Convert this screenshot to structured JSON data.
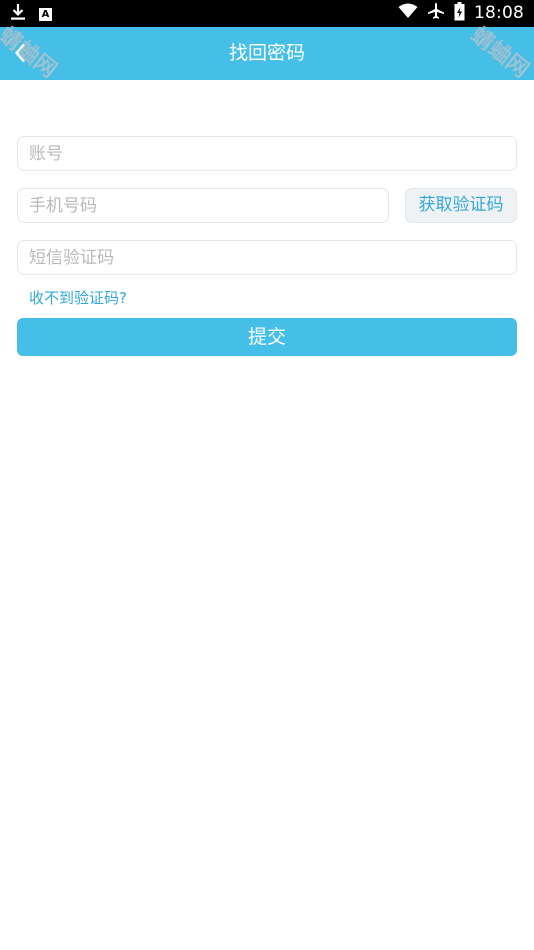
{
  "status_bar": {
    "time": "18:08",
    "notification_icons": [
      "download-icon",
      "a-icon"
    ],
    "system_icons": [
      "wifi-icon",
      "airplane-icon",
      "battery-icon"
    ],
    "a_glyph": "A"
  },
  "header": {
    "title": "找回密码",
    "back_icon": "chevron-left-icon",
    "watermark_text": "蜻蛐网",
    "background_color": "#45bfe8"
  },
  "form": {
    "account_placeholder": "账号",
    "account_value": "",
    "phone_placeholder": "手机号码",
    "phone_value": "",
    "get_code_label": "获取验证码",
    "sms_placeholder": "短信验证码",
    "sms_value": "",
    "no_code_link": "收不到验证码?",
    "submit_label": "提交"
  },
  "colors": {
    "accent": "#45bfe8",
    "link": "#34a8d8",
    "placeholder": "#b9b9b9"
  }
}
